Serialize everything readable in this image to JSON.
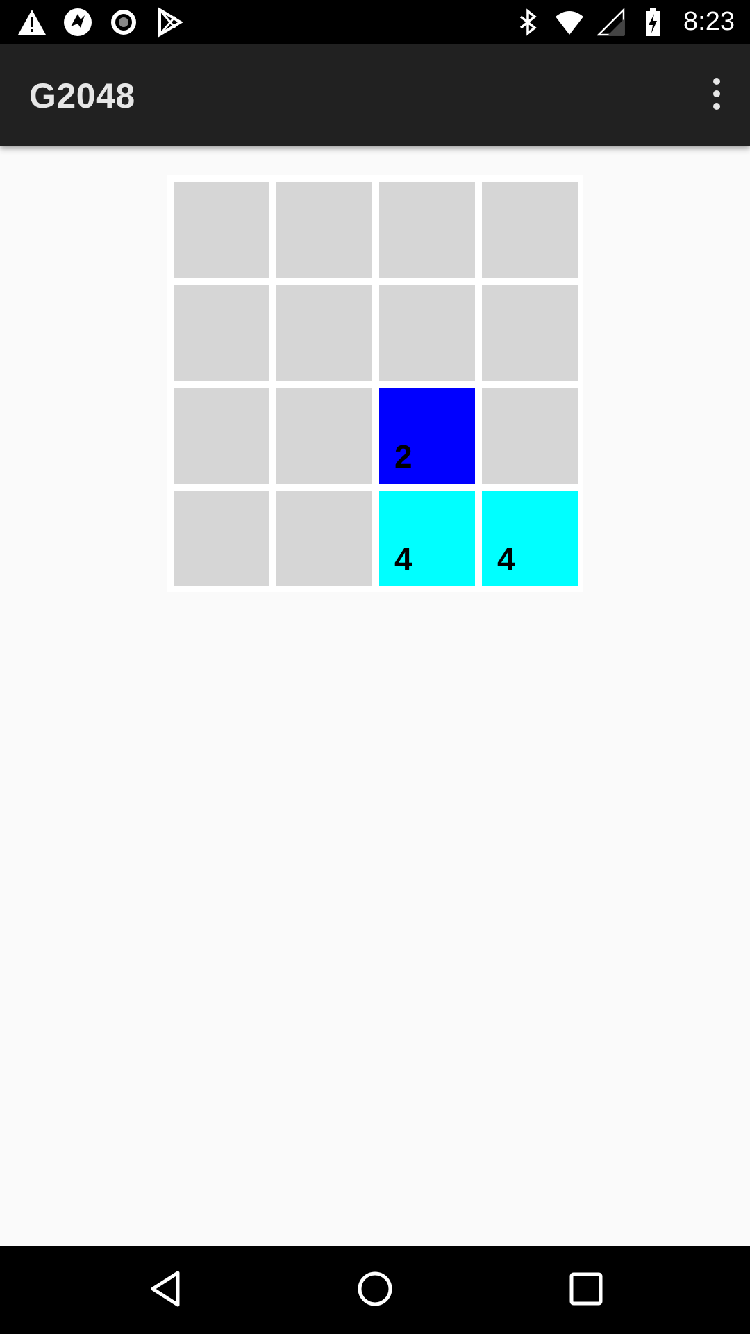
{
  "status_bar": {
    "left_icons": [
      "warning-icon",
      "sync-icon",
      "record-icon",
      "play-store-icon"
    ],
    "right_icons": [
      "bluetooth-icon",
      "wifi-icon",
      "cell-signal-icon",
      "battery-charging-icon"
    ],
    "time": "8:23"
  },
  "app_bar": {
    "title": "G2048",
    "menu_icon": "more-vert-icon"
  },
  "board": {
    "rows": 4,
    "cols": 4,
    "tiles": [
      [
        null,
        null,
        null,
        null
      ],
      [
        null,
        null,
        null,
        null
      ],
      [
        null,
        null,
        2,
        null
      ],
      [
        null,
        null,
        4,
        4
      ]
    ],
    "colors": {
      "empty": "#d6d6d6",
      "2": "#0000ff",
      "4": "#00ffff"
    }
  },
  "nav_bar": {
    "buttons": [
      "back-icon",
      "home-icon",
      "recents-icon"
    ]
  }
}
